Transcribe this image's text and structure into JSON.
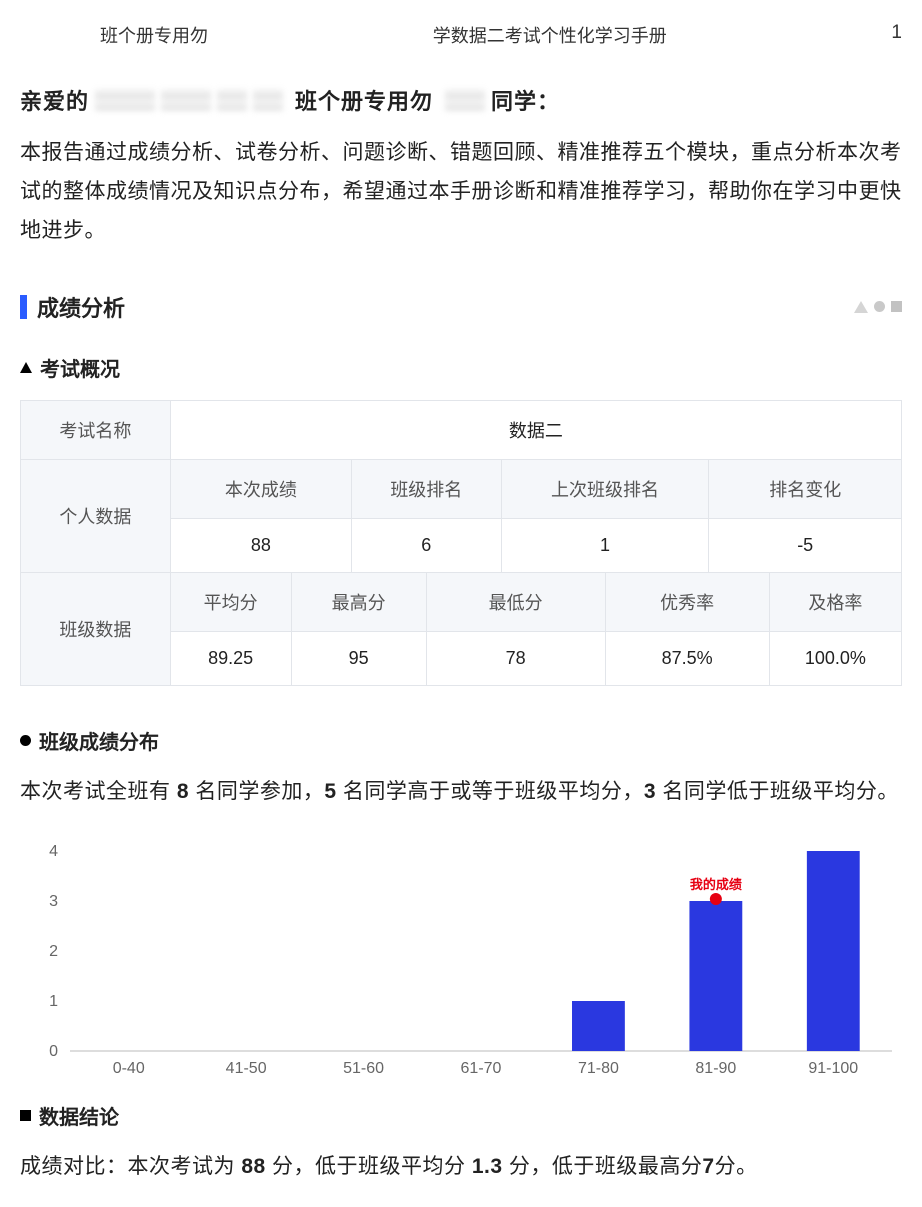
{
  "header": {
    "left": "班个册专用勿",
    "center": "学数据二考试个性化学习手册",
    "page_no": "1"
  },
  "greeting": {
    "prefix": "亲爱的",
    "mid": "班个册专用勿",
    "suffix": "同学："
  },
  "intro": "本报告通过成绩分析、试卷分析、问题诊断、错题回顾、精准推荐五个模块，重点分析本次考试的整体成绩情况及知识点分布，希望通过本手册诊断和精准推荐学习，帮助你在学习中更快地进步。",
  "section": {
    "title": "成绩分析"
  },
  "overview": {
    "title": "考试概况",
    "table": {
      "exam_name_label": "考试名称",
      "exam_name_value": "数据二",
      "personal_label": "个人数据",
      "personal_headers": [
        "本次成绩",
        "班级排名",
        "上次班级排名",
        "排名变化"
      ],
      "personal_values": [
        "88",
        "6",
        "1",
        "-5"
      ],
      "class_label": "班级数据",
      "class_headers": [
        "平均分",
        "最高分",
        "最低分",
        "优秀率",
        "及格率"
      ],
      "class_values": [
        "89.25",
        "95",
        "78",
        "87.5%",
        "100.0%"
      ]
    }
  },
  "dist": {
    "title": "班级成绩分布",
    "text_parts": [
      "本次考试全班有 ",
      "8",
      " 名同学参加，",
      "5",
      " 名同学高于或等于班级平均分，",
      "3",
      " 名同学低于班级平均分。"
    ]
  },
  "chart_data": {
    "type": "bar",
    "categories": [
      "0-40",
      "41-50",
      "51-60",
      "61-70",
      "71-80",
      "81-90",
      "91-100"
    ],
    "values": [
      0,
      0,
      0,
      0,
      1,
      3,
      4
    ],
    "ylim": [
      0,
      4
    ],
    "yticks": [
      0,
      1,
      2,
      3,
      4
    ],
    "my_score_label": "我的成绩",
    "my_score_category_index": 5,
    "ylabel": "",
    "xlabel": ""
  },
  "conclusion": {
    "title": "数据结论",
    "text_parts": [
      "成绩对比：本次考试为 ",
      "88",
      " 分，低于班级平均分 ",
      "1.3",
      " 分，低于班级最高分",
      "7",
      "分。"
    ]
  }
}
